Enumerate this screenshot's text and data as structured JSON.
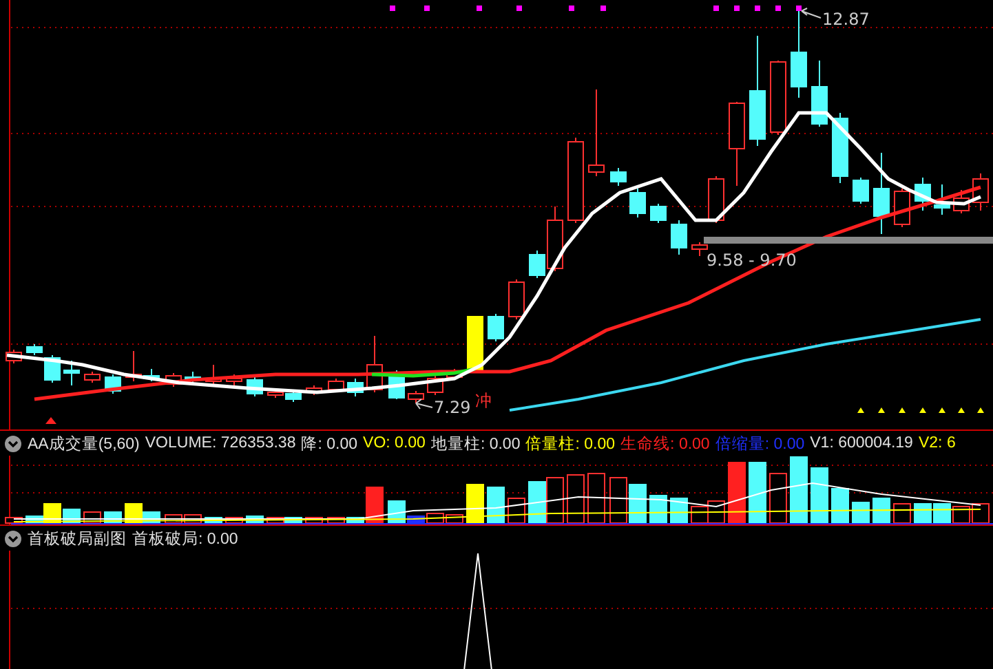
{
  "main_chart": {
    "annotations": [
      {
        "kind": "high",
        "text": "12.87"
      },
      {
        "kind": "band",
        "text": "9.58 - 9.70"
      },
      {
        "kind": "low",
        "text": "7.29"
      },
      {
        "kind": "signal",
        "text": "冲"
      }
    ]
  },
  "volume_panel": {
    "title": "AA成交量(5,60)",
    "fields": [
      {
        "label": "VOLUME:",
        "value": "726353.38",
        "color": "#e0e0e0"
      },
      {
        "label": "降:",
        "value": "0.00",
        "color": "#e0e0e0"
      },
      {
        "label": "VO:",
        "value": "0.00",
        "color": "#ffff00"
      },
      {
        "label": "地量柱:",
        "value": "0.00",
        "color": "#e0e0e0"
      },
      {
        "label": "倍量柱:",
        "value": "0.00",
        "color": "#ffff00"
      },
      {
        "label": "生命线:",
        "value": "0.00",
        "color": "#ff2020"
      },
      {
        "label": "倍缩量:",
        "value": "0.00",
        "color": "#2030ff"
      },
      {
        "label": "V1:",
        "value": "600004.19",
        "color": "#e0e0e0"
      },
      {
        "label": "V2:",
        "value": "6",
        "color": "#ffff00"
      }
    ]
  },
  "signal_panel": {
    "title": "首板破局副图",
    "fields": [
      {
        "label": "首板破局:",
        "value": "0.00",
        "color": "#e0e0e0"
      }
    ]
  }
}
